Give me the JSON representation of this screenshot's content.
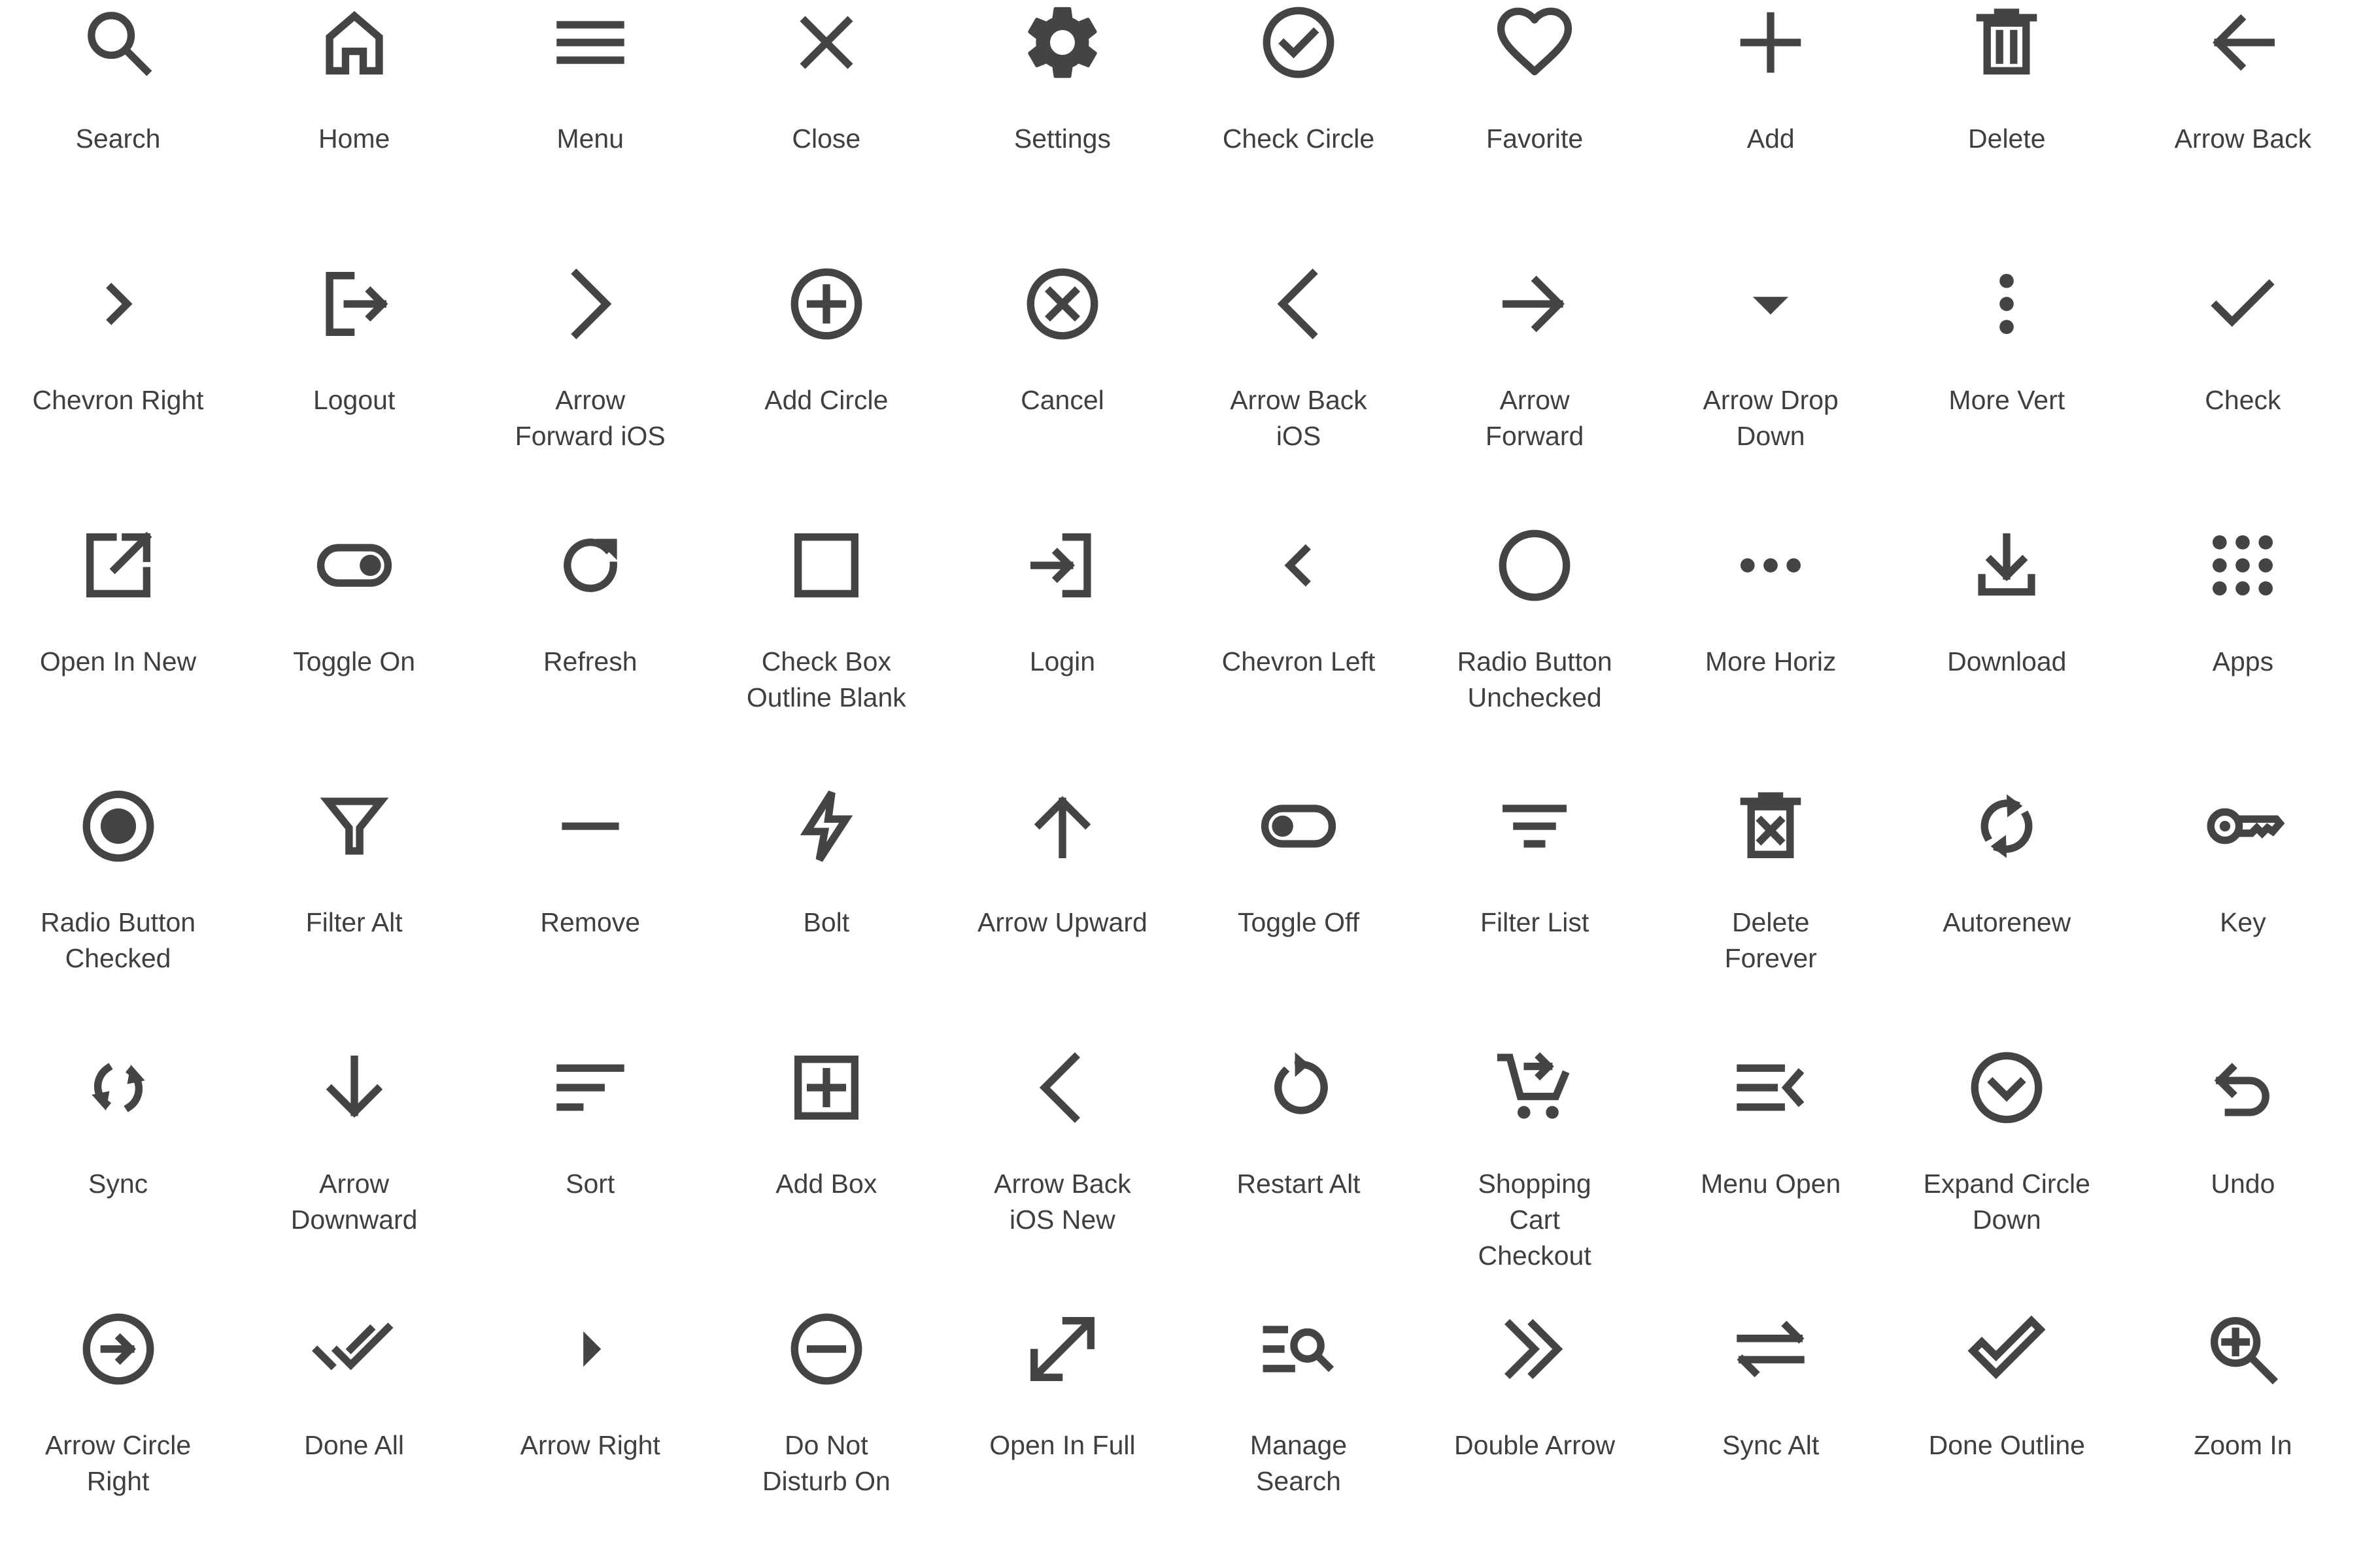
{
  "icons": [
    {
      "name": "search-icon",
      "label": "Search"
    },
    {
      "name": "home-icon",
      "label": "Home"
    },
    {
      "name": "menu-icon",
      "label": "Menu"
    },
    {
      "name": "close-icon",
      "label": "Close"
    },
    {
      "name": "settings-icon",
      "label": "Settings"
    },
    {
      "name": "check-circle-icon",
      "label": "Check Circle"
    },
    {
      "name": "favorite-icon",
      "label": "Favorite"
    },
    {
      "name": "add-icon",
      "label": "Add"
    },
    {
      "name": "delete-icon",
      "label": "Delete"
    },
    {
      "name": "arrow-back-icon",
      "label": "Arrow Back"
    },
    {
      "name": "chevron-right-icon",
      "label": "Chevron Right"
    },
    {
      "name": "logout-icon",
      "label": "Logout"
    },
    {
      "name": "arrow-forward-ios-icon",
      "label": "Arrow\nForward iOS"
    },
    {
      "name": "add-circle-icon",
      "label": "Add Circle"
    },
    {
      "name": "cancel-icon",
      "label": "Cancel"
    },
    {
      "name": "arrow-back-ios-icon",
      "label": "Arrow Back\niOS"
    },
    {
      "name": "arrow-forward-icon",
      "label": "Arrow\nForward"
    },
    {
      "name": "arrow-drop-down-icon",
      "label": "Arrow Drop\nDown"
    },
    {
      "name": "more-vert-icon",
      "label": "More Vert"
    },
    {
      "name": "check-icon",
      "label": "Check"
    },
    {
      "name": "open-in-new-icon",
      "label": "Open In New"
    },
    {
      "name": "toggle-on-icon",
      "label": "Toggle On"
    },
    {
      "name": "refresh-icon",
      "label": "Refresh"
    },
    {
      "name": "check-box-outline-blank-icon",
      "label": "Check Box\nOutline Blank"
    },
    {
      "name": "login-icon",
      "label": "Login"
    },
    {
      "name": "chevron-left-icon",
      "label": "Chevron Left"
    },
    {
      "name": "radio-button-unchecked-icon",
      "label": "Radio Button\nUnchecked"
    },
    {
      "name": "more-horiz-icon",
      "label": "More Horiz"
    },
    {
      "name": "download-icon",
      "label": "Download"
    },
    {
      "name": "apps-icon",
      "label": "Apps"
    },
    {
      "name": "radio-button-checked-icon",
      "label": "Radio Button\nChecked"
    },
    {
      "name": "filter-alt-icon",
      "label": "Filter Alt"
    },
    {
      "name": "remove-icon",
      "label": "Remove"
    },
    {
      "name": "bolt-icon",
      "label": "Bolt"
    },
    {
      "name": "arrow-upward-icon",
      "label": "Arrow Upward"
    },
    {
      "name": "toggle-off-icon",
      "label": "Toggle Off"
    },
    {
      "name": "filter-list-icon",
      "label": "Filter List"
    },
    {
      "name": "delete-forever-icon",
      "label": "Delete\nForever"
    },
    {
      "name": "autorenew-icon",
      "label": "Autorenew"
    },
    {
      "name": "key-icon",
      "label": "Key"
    },
    {
      "name": "sync-icon",
      "label": "Sync"
    },
    {
      "name": "arrow-downward-icon",
      "label": "Arrow\nDownward"
    },
    {
      "name": "sort-icon",
      "label": "Sort"
    },
    {
      "name": "add-box-icon",
      "label": "Add Box"
    },
    {
      "name": "arrow-back-ios-new-icon",
      "label": "Arrow Back\niOS New"
    },
    {
      "name": "restart-alt-icon",
      "label": "Restart Alt"
    },
    {
      "name": "shopping-cart-checkout-icon",
      "label": "Shopping\nCart\nCheckout"
    },
    {
      "name": "menu-open-icon",
      "label": "Menu Open"
    },
    {
      "name": "expand-circle-down-icon",
      "label": "Expand Circle\nDown"
    },
    {
      "name": "undo-icon",
      "label": "Undo"
    },
    {
      "name": "arrow-circle-right-icon",
      "label": "Arrow Circle\nRight"
    },
    {
      "name": "done-all-icon",
      "label": "Done All"
    },
    {
      "name": "arrow-right-icon",
      "label": "Arrow Right"
    },
    {
      "name": "do-not-disturb-on-icon",
      "label": "Do Not\nDisturb On"
    },
    {
      "name": "open-in-full-icon",
      "label": "Open In Full"
    },
    {
      "name": "manage-search-icon",
      "label": "Manage\nSearch"
    },
    {
      "name": "double-arrow-icon",
      "label": "Double Arrow"
    },
    {
      "name": "sync-alt-icon",
      "label": "Sync Alt"
    },
    {
      "name": "done-outline-icon",
      "label": "Done Outline"
    },
    {
      "name": "zoom-in-icon",
      "label": "Zoom In"
    }
  ],
  "colors": {
    "icon": "#444444",
    "text": "#3f3f3f",
    "background": "#ffffff"
  }
}
